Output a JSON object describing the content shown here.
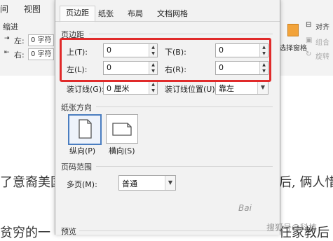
{
  "ribbon": {
    "tabs": [
      "间",
      "视图"
    ],
    "indent_label": "缩进",
    "left_label": "左:",
    "right_label": "右:",
    "left_value": "0 字符",
    "right_value": "0 字符",
    "align_label": "对齐",
    "select_pane_label": "选择窗格",
    "group_label": "组合",
    "rotate_label": "旋转"
  },
  "document": {
    "line1_left": "了意裔美国",
    "line1_right": "后, 俩人惜",
    "line2_left": "贫穷的一",
    "line2_right": "任家教后"
  },
  "dialog": {
    "tabs": [
      "页边距",
      "纸张",
      "布局",
      "文档网格"
    ],
    "margins": {
      "section": "页边距",
      "top_label": "上(T):",
      "top_value": "0",
      "bottom_label": "下(B):",
      "bottom_value": "0",
      "left_label": "左(L):",
      "left_value": "0",
      "right_label": "右(R):",
      "right_value": "0",
      "gutter_label": "装订线(G):",
      "gutter_value": "0 厘米",
      "gutter_pos_label": "装订线位置(U):",
      "gutter_pos_value": "靠左"
    },
    "orientation": {
      "section": "纸张方向",
      "portrait": "纵向(P)",
      "landscape": "横向(S)"
    },
    "pages": {
      "section": "页码范围",
      "multi_label": "多页(M):",
      "multi_value": "普通"
    },
    "preview": {
      "section": "预览"
    }
  },
  "watermark": {
    "text1": "Bai",
    "text2": "搜狐号@科技"
  },
  "colors": {
    "highlight": "#e02a2a",
    "selected_border": "#4a7dc0"
  }
}
